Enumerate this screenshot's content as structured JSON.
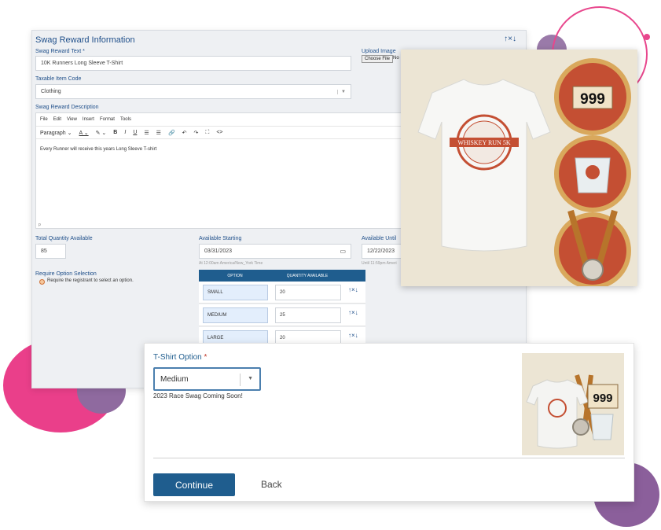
{
  "panel": {
    "title": "Swag Reward Information",
    "arrows": "↑×↓",
    "reward_text_label": "Swag Reward Text *",
    "reward_text_value": "10K Runners Long Sleeve T-Shirt",
    "upload_label": "Upload Image",
    "choose_file": "Choose File",
    "no_file": "No",
    "taxable_label": "Taxable Item Code",
    "taxable_value": "Clothing",
    "description_label": "Swag Reward Description",
    "editor_menu": [
      "File",
      "Edit",
      "View",
      "Insert",
      "Format",
      "Tools"
    ],
    "editor_toolbar": {
      "paragraph": "Paragraph",
      "buttons": [
        "A",
        "B",
        "I",
        "U",
        "≡",
        "≡",
        "🔗",
        "↶",
        "↷",
        "⛶",
        "<>"
      ]
    },
    "editor_body": "Every Runner will receive this years Long Sleeve T-shirt",
    "editor_p": "p",
    "qty_label": "Total Quantity Available",
    "qty_value": "85",
    "start_label": "Available Starting",
    "start_value": "03/31/2023",
    "start_note": "At 12:00am America/New_York Time",
    "until_label": "Available Until",
    "until_value": "12/22/2023",
    "until_note": "Until 11:59pm Ameri",
    "require_label": "Require Option Selection",
    "require_option": "Require the registrant to select an option.",
    "options_table": {
      "headers": [
        "OPTION",
        "QUANTITY AVAILABLE"
      ],
      "rows": [
        {
          "option": "SMALL",
          "qty": "20"
        },
        {
          "option": "MEDIUM",
          "qty": "25"
        },
        {
          "option": "LARGE",
          "qty": "20"
        }
      ],
      "row_arrows": "↑×↓"
    }
  },
  "swag_image": {
    "bib_number": "999",
    "logo_text": "WHISKEY RUN 5K"
  },
  "front": {
    "option_label": "T-Shirt Option",
    "required_mark": "*",
    "selected_size": "Medium",
    "coming_soon": "2023 Race Swag Coming Soon!",
    "thumb_bib": "999",
    "continue": "Continue",
    "back": "Back"
  },
  "colors": {
    "brand_blue": "#1f5d8e",
    "pink": "#ea3f8a",
    "purple": "#8b5f9b",
    "rust": "#c44f33"
  }
}
